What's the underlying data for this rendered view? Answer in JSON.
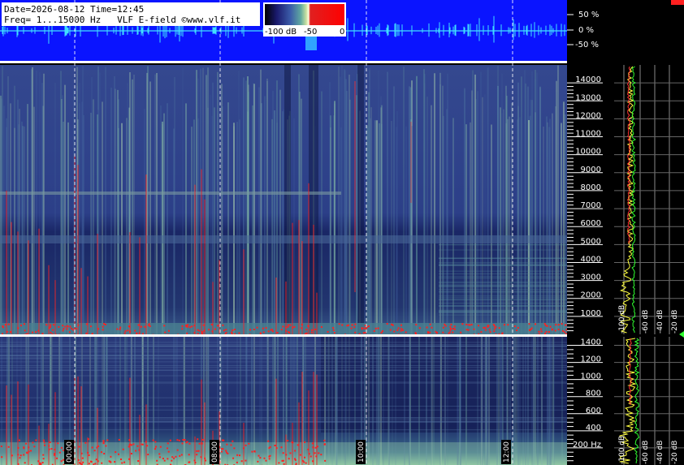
{
  "header": {
    "line1": "Date=2026-08-12 Time=12:45",
    "line2": "Freq= 1...15000 Hz   VLF E-field ©www.vlf.it"
  },
  "colorbar": {
    "labels": [
      "-100 dB",
      "-50",
      "0"
    ],
    "colors": [
      "#000000",
      "#1a1a6e",
      "#3b5ba8",
      "#5fa8a0",
      "#c8e0a0",
      "#ffffe0",
      "#e02020",
      "#ff0000"
    ]
  },
  "waveform": {
    "labels": [
      "50 %",
      "0 %",
      "-50 %"
    ],
    "background": "#0a14ff"
  },
  "upper_axis": {
    "ticks": [
      "14000",
      "13000",
      "12000",
      "11000",
      "10000",
      "9000",
      "8000",
      "7000",
      "6000",
      "5000",
      "4000",
      "3000",
      "2000",
      "1000"
    ]
  },
  "lower_axis": {
    "ticks": [
      "1400",
      "1200",
      "1000",
      "800",
      "600",
      "400",
      "200 Hz"
    ]
  },
  "spectrum_axis": {
    "labels": [
      "-100 dB",
      "-60 dB",
      "-40 dB",
      "-20 dB"
    ]
  },
  "time_markers": [
    "00:00",
    "08:00",
    "10:00",
    "12:00"
  ],
  "colors": {
    "spectrogram_base": "#2a3a8a",
    "spectrogram_dark": "#14205a",
    "lightning_red": "#ff2020",
    "trace_yellow": "#ffff40",
    "trace_green": "#30ff30",
    "trace_red": "#ff3030"
  }
}
